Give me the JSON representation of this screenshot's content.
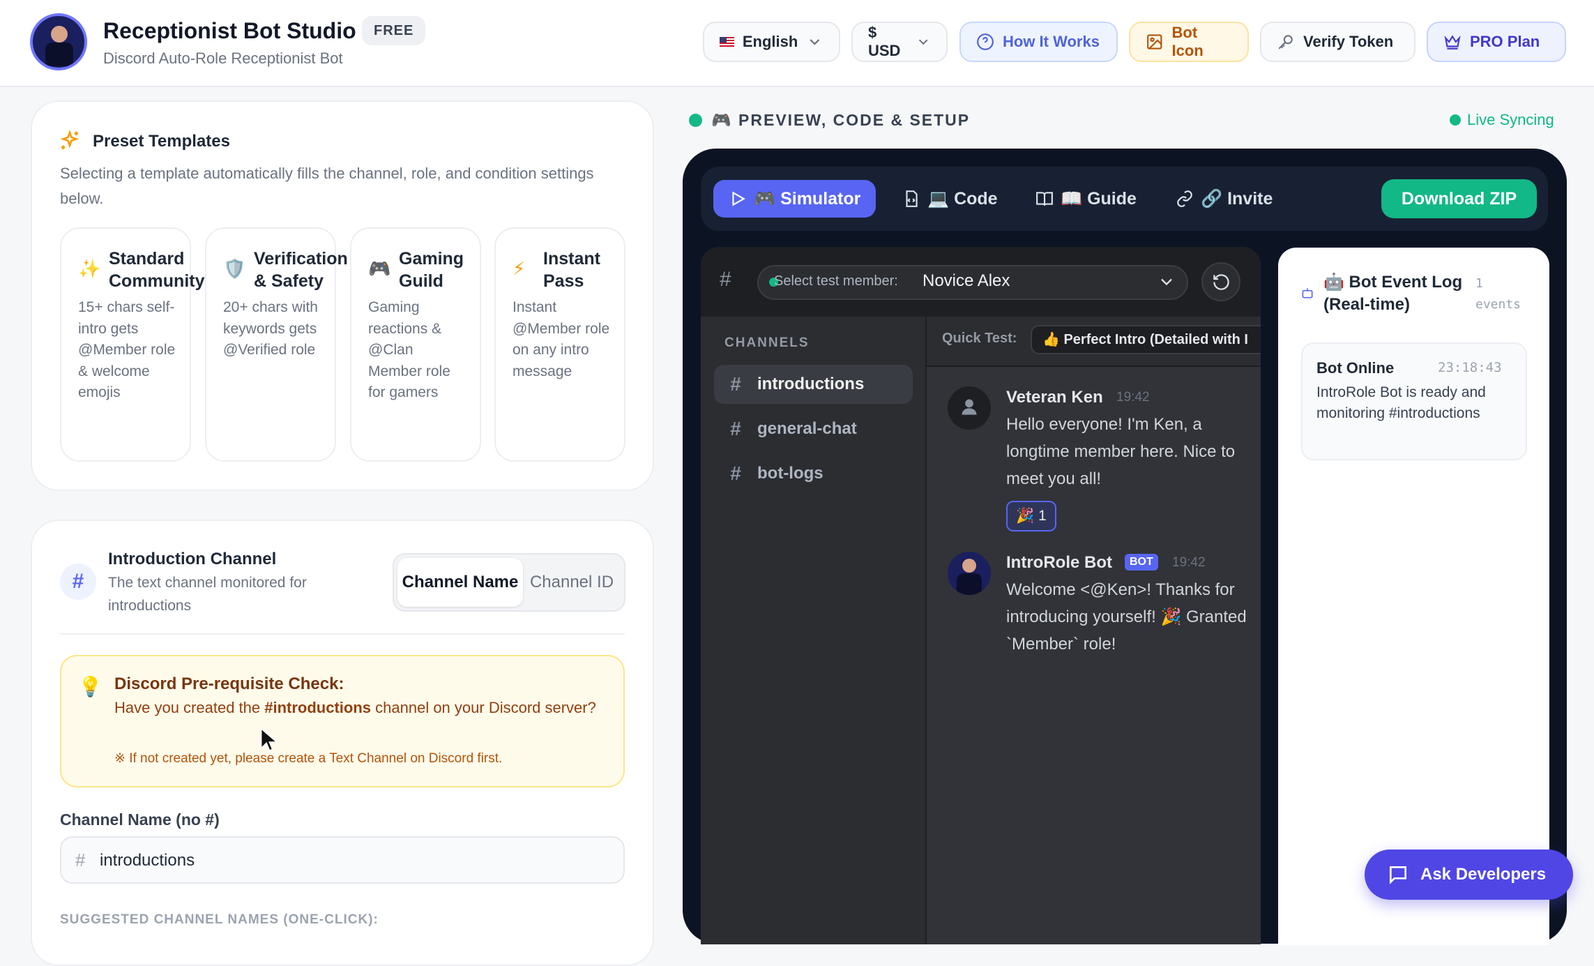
{
  "header": {
    "app_title": "Receptionist Bot Studio",
    "badge": "FREE",
    "subtitle": "Discord Auto-Role Receptionist Bot",
    "language": "English",
    "currency": "$ USD",
    "how_it_works": "How It Works",
    "bot_icon": "Bot Icon",
    "verify_token": "Verify Token",
    "pro_plan": "PRO Plan"
  },
  "templates": {
    "title": "Preset Templates",
    "description": "Selecting a template automatically fills the channel, role, and condition settings below.",
    "items": [
      {
        "icon": "✨",
        "title": "Standard Community",
        "desc": "15+ chars self-intro gets @Member role & welcome emojis"
      },
      {
        "icon": "🛡️",
        "title": "Verification & Safety",
        "desc": "20+ chars with keywords gets @Verified role"
      },
      {
        "icon": "🎮",
        "title": "Gaming Guild",
        "desc": "Gaming reactions & @Clan Member role for gamers"
      },
      {
        "icon": "⚡",
        "title": "Instant Pass",
        "desc": "Instant @Member role on any intro message"
      }
    ]
  },
  "intro_channel": {
    "title": "Introduction Channel",
    "description": "The text channel monitored for introductions",
    "toggle_name": "Channel Name",
    "toggle_id": "Channel ID",
    "check_title": "Discord Pre-requisite Check:",
    "check_text_1": "Have you created the ",
    "check_channel": "#introductions",
    "check_text_2": " channel on your Discord server?",
    "check_note": "※ If not created yet, please create a Text Channel on Discord first.",
    "field_label": "Channel Name (no #)",
    "field_value": "introductions",
    "suggested_label": "SUGGESTED CHANNEL NAMES (ONE-CLICK):"
  },
  "preview": {
    "title": "🎮 PREVIEW, CODE & SETUP",
    "live": "Live Syncing",
    "tabs": {
      "simulator": "🎮 Simulator",
      "code": "💻 Code",
      "guide": "📖 Guide",
      "invite": "🔗 Invite"
    },
    "download": "Download ZIP",
    "member_label": "Select test member:",
    "member_value": "Novice Alex",
    "channels_label": "CHANNELS",
    "channels": [
      "introductions",
      "general-chat",
      "bot-logs"
    ],
    "quick_test_label": "Quick Test:",
    "quick_test_value": "👍 Perfect Intro (Detailed with I",
    "messages": [
      {
        "author": "Veteran Ken",
        "time": "19:42",
        "text": "Hello everyone! I'm Ken, a longtime member here. Nice to meet you all!",
        "reaction": "🎉 1"
      },
      {
        "author": "IntroRole Bot",
        "badge": "BOT",
        "time": "19:42",
        "text": "Welcome <@Ken>! Thanks for introducing yourself! 🎉 Granted `Member` role!"
      }
    ],
    "log": {
      "title": "🤖 Bot Event Log (Real-time)",
      "count": "1 events",
      "event_title": "Bot Online",
      "event_time": "23:18:43",
      "event_text": "IntroRole Bot is ready and monitoring #introductions"
    }
  },
  "ask_developers": "Ask Developers",
  "colors": {
    "accent": "#5865f2",
    "green": "#12b886",
    "panel": "#0c1424"
  }
}
